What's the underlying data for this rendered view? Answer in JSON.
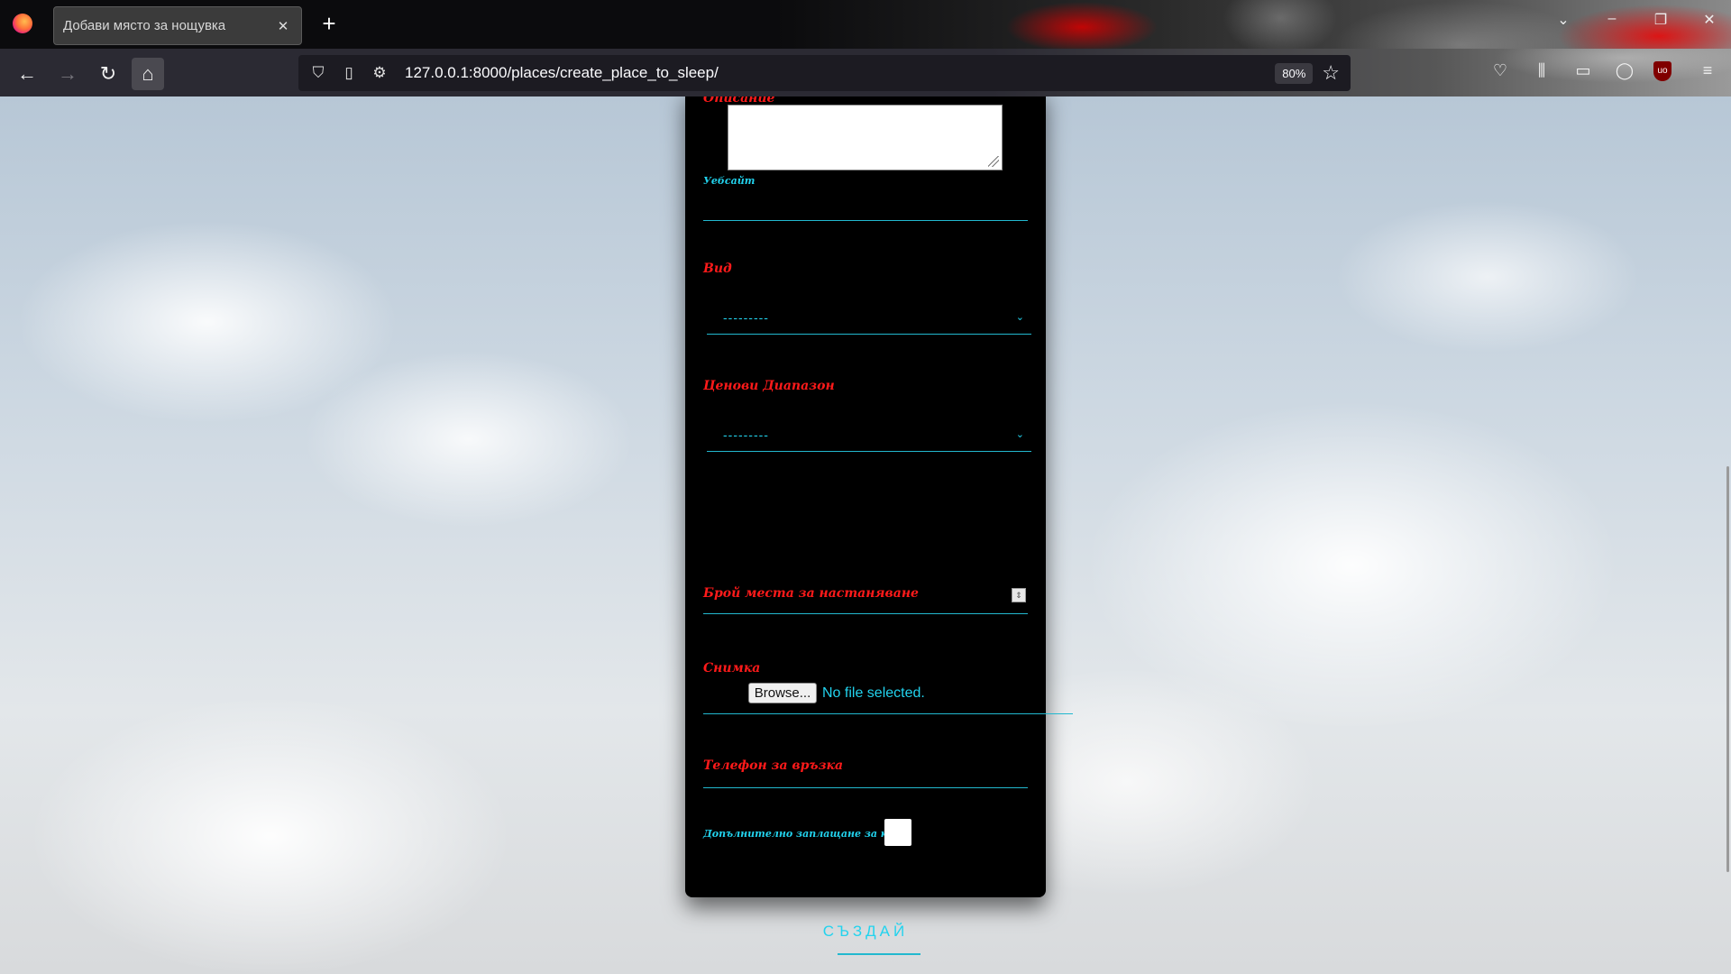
{
  "browser": {
    "tab_title": "Добави място за нощувка",
    "tab_close": "✕",
    "new_tab": "+",
    "url": "127.0.0.1:8000/places/create_place_to_sleep/",
    "zoom": "80%"
  },
  "form": {
    "description_label": "Описание",
    "website_label": "Уебсайт",
    "type_label": "Вид",
    "type_value": "---------",
    "price_range_label": "Ценови Диапазон",
    "price_range_value": "---------",
    "capacity_label": "Брой места за настаняване",
    "photo_label": "Снимка",
    "browse_button": "Browse...",
    "file_status": "No file selected.",
    "phone_label": "Телефон за връзка",
    "dog_fee_label": "Допълнително заплащане за куче",
    "dog_fee_checked": false,
    "submit_label": "СЪЗДАЙ"
  },
  "colors": {
    "label_red": "#ff1a1a",
    "accent_cyan": "#22d3ee",
    "card_bg": "#000000"
  }
}
